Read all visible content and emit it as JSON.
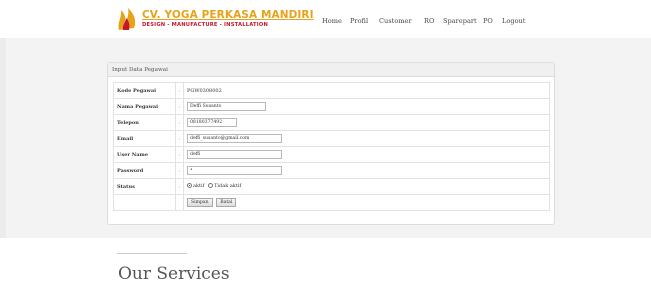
{
  "brand": {
    "title": "CV. YOGA PERKASA MANDIRI",
    "subtitle": "DESIGN - MANUFACTURE - INSTALLATION",
    "colors": {
      "title": "#e8a21a",
      "subtitle": "#c5172b"
    },
    "logo_icon": "flame-logo-icon"
  },
  "nav": {
    "items": [
      "Home",
      "Profil",
      "Customer",
      "RO",
      "Sparepart",
      "PO",
      "Logout"
    ]
  },
  "form": {
    "heading": "Input Data Pegawai",
    "separator": ":",
    "rows": {
      "kode": {
        "label": "Kode Pegawai",
        "value": "PGW0308002"
      },
      "nama": {
        "label": "Nama Pegawai",
        "value": "Deffi Susanto"
      },
      "telepon": {
        "label": "Telepon",
        "value": "08180377492"
      },
      "email": {
        "label": "Email",
        "value": "deffi_susanto@gmail.com"
      },
      "username": {
        "label": "User Name",
        "value": "deffi"
      },
      "password": {
        "label": "Password",
        "value": "•"
      },
      "status": {
        "label": "Status",
        "option_active": "aktif",
        "option_inactive": "Tidak aktif"
      }
    },
    "buttons": {
      "save": "Simpan",
      "reset": "Batal"
    }
  },
  "services": {
    "title": "Our Services"
  }
}
